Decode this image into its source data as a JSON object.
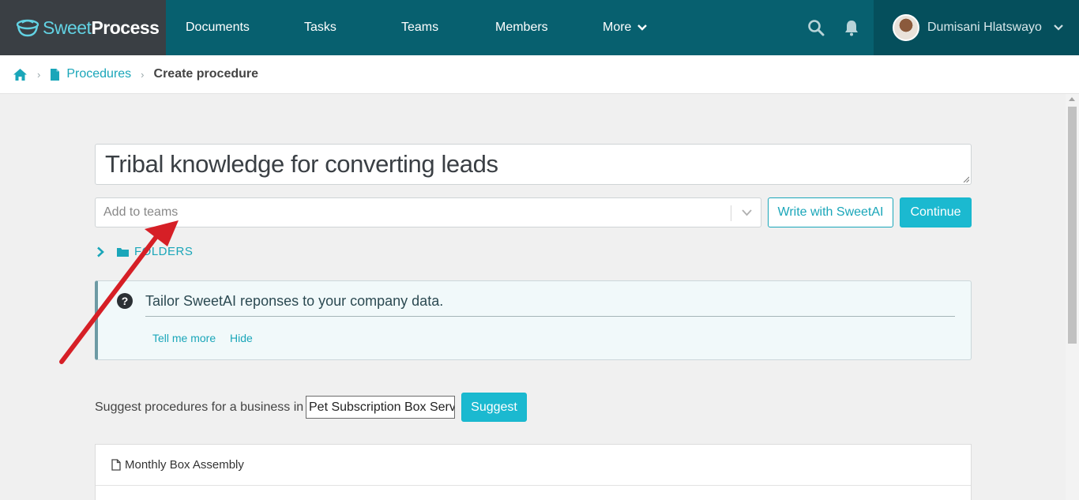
{
  "brand": {
    "sweet": "Sweet",
    "process": "Process"
  },
  "nav": {
    "documents": "Documents",
    "tasks": "Tasks",
    "teams": "Teams",
    "members": "Members",
    "more": "More"
  },
  "user": {
    "name": "Dumisani Hlatswayo"
  },
  "breadcrumb": {
    "procedures": "Procedures",
    "current": "Create procedure"
  },
  "form": {
    "title_value": "Tribal knowledge for converting leads",
    "teams_placeholder": "Add to teams",
    "write_ai_label": "Write with SweetAI",
    "continue_label": "Continue",
    "folders_label": "FOLDERS"
  },
  "info": {
    "text": "Tailor SweetAI reponses to your company data.",
    "tell_more": "Tell me more",
    "hide": "Hide"
  },
  "suggest": {
    "label": "Suggest procedures for a business in",
    "value": "Pet Subscription Box Service",
    "button": "Suggest"
  },
  "suggestions": [
    {
      "label": "Monthly Box Assembly"
    }
  ],
  "colors": {
    "accent": "#1bb9d0",
    "nav_bg": "#07606f",
    "annotation_arrow": "#d61f26"
  }
}
